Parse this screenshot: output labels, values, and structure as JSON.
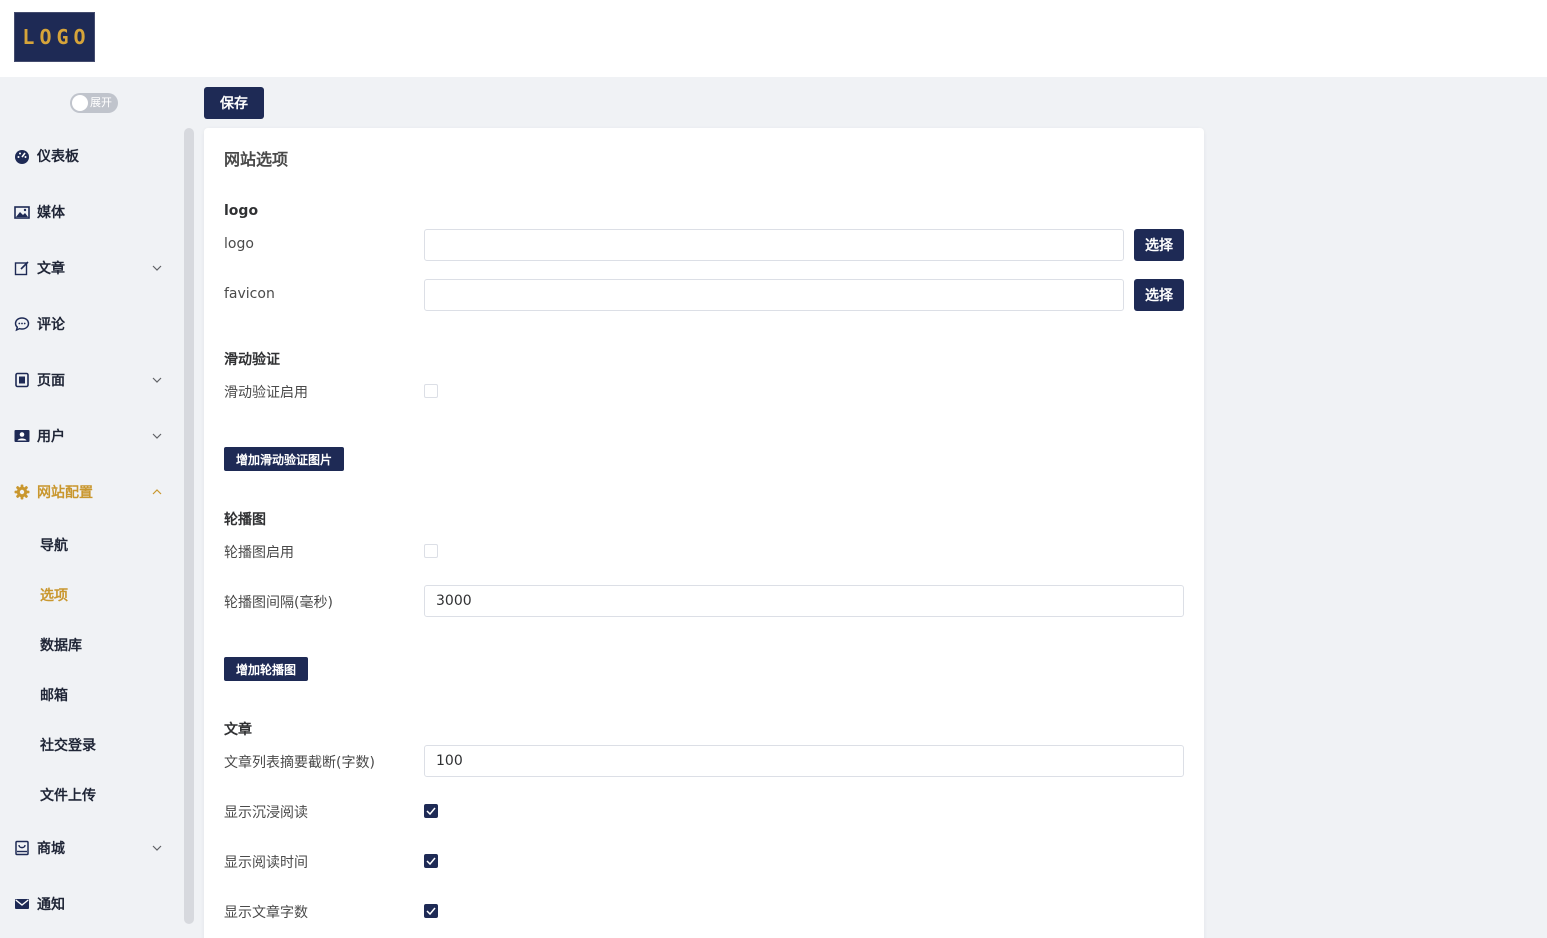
{
  "header": {
    "logo_text": "LOGO"
  },
  "toolbar": {
    "toggle_label": "展开",
    "save_label": "保存"
  },
  "sidebar": {
    "items": [
      {
        "label": "仪表板",
        "icon": "dashboard-icon"
      },
      {
        "label": "媒体",
        "icon": "image-icon"
      },
      {
        "label": "文章",
        "icon": "edit-icon",
        "expandable": true
      },
      {
        "label": "评论",
        "icon": "comment-icon"
      },
      {
        "label": "页面",
        "icon": "page-icon",
        "expandable": true
      },
      {
        "label": "用户",
        "icon": "user-icon",
        "expandable": true
      },
      {
        "label": "网站配置",
        "icon": "gear-icon",
        "expandable": true,
        "expanded": true
      },
      {
        "label": "商城",
        "icon": "shop-icon",
        "expandable": true
      },
      {
        "label": "通知",
        "icon": "mail-icon"
      }
    ],
    "sub_items": [
      {
        "label": "导航"
      },
      {
        "label": "选项",
        "active": true
      },
      {
        "label": "数据库"
      },
      {
        "label": "邮箱"
      },
      {
        "label": "社交登录"
      },
      {
        "label": "文件上传"
      }
    ]
  },
  "card": {
    "title": "网站选项",
    "logo_section": {
      "heading": "logo",
      "logo_label": "logo",
      "logo_value": "",
      "favicon_label": "favicon",
      "favicon_value": "",
      "choose_label": "选择"
    },
    "slider_section": {
      "heading": "滑动验证",
      "enable_label": "滑动验证启用",
      "enabled": false,
      "add_button": "增加滑动验证图片"
    },
    "carousel_section": {
      "heading": "轮播图",
      "enable_label": "轮播图启用",
      "enabled": false,
      "interval_label": "轮播图间隔(毫秒)",
      "interval_value": "3000",
      "add_button": "增加轮播图"
    },
    "article_section": {
      "heading": "文章",
      "excerpt_label": "文章列表摘要截断(字数)",
      "excerpt_value": "100",
      "immersive_label": "显示沉浸阅读",
      "immersive_checked": true,
      "read_time_label": "显示阅读时间",
      "read_time_checked": true,
      "word_count_label": "显示文章字数",
      "word_count_checked": true
    }
  },
  "colors": {
    "primary": "#1e2a55",
    "accent": "#c9972e",
    "background": "#f0f2f5"
  }
}
